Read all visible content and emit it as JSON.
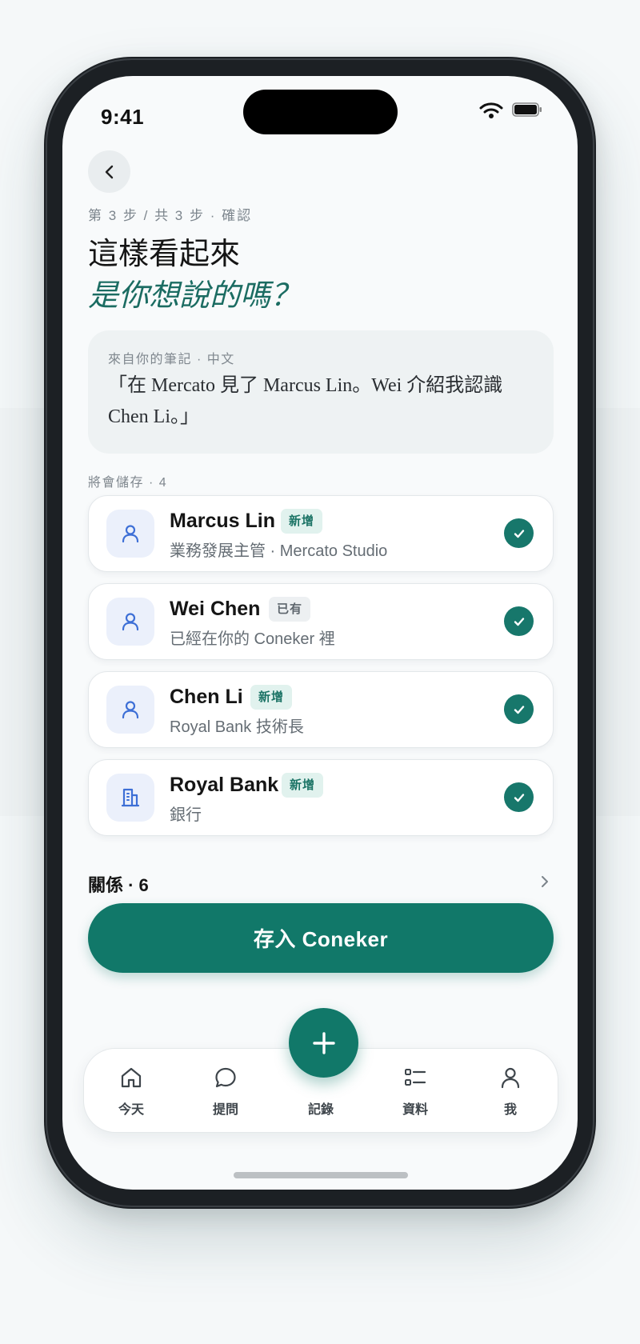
{
  "status": {
    "time": "9:41"
  },
  "header": {
    "step": "第 3 步 / 共 3 步 · 確認",
    "title_line1": "這樣看起來",
    "title_line2": "是你想說的嗎？"
  },
  "note": {
    "source": "來自你的筆記 · 中文",
    "quote": "「在 Mercato 見了 Marcus Lin。Wei 介紹我認識 Chen Li。」"
  },
  "save_section": {
    "label": "將會儲存 · 4"
  },
  "entities": [
    {
      "name": "Marcus Lin",
      "badge": "新增",
      "badge_type": "new",
      "subtitle": "業務發展主管 · Mercato Studio",
      "icon": "person-icon",
      "checked": true
    },
    {
      "name": "Wei Chen",
      "badge": "已有",
      "badge_type": "existing",
      "subtitle": "已經在你的 Coneker 裡",
      "icon": "person-icon",
      "checked": true
    },
    {
      "name": "Chen Li",
      "badge": "新增",
      "badge_type": "new",
      "subtitle": "Royal Bank 技術長",
      "icon": "person-icon",
      "checked": true
    },
    {
      "name": "Royal Bank",
      "badge": "新增",
      "badge_type": "new",
      "subtitle": "銀行",
      "icon": "building-icon",
      "checked": true
    }
  ],
  "relations": {
    "label": "關係 · 6"
  },
  "primary_action": {
    "label": "存入 Coneker"
  },
  "tabbar": {
    "tabs": [
      {
        "label": "今天",
        "icon": "home-icon"
      },
      {
        "label": "提問",
        "icon": "chat-bubble-icon"
      },
      {
        "label": "記錄",
        "icon": "plus-icon"
      },
      {
        "label": "資料",
        "icon": "list-icon"
      },
      {
        "label": "我",
        "icon": "user-icon"
      }
    ]
  },
  "colors": {
    "accent": "#117869",
    "accent_text": "#1b6c62",
    "avatar_bg": "#ebf0fb",
    "avatar_icon": "#3d6fd6",
    "badge_new_bg": "#e1f2ee",
    "badge_existing_bg": "#edf0f2"
  }
}
